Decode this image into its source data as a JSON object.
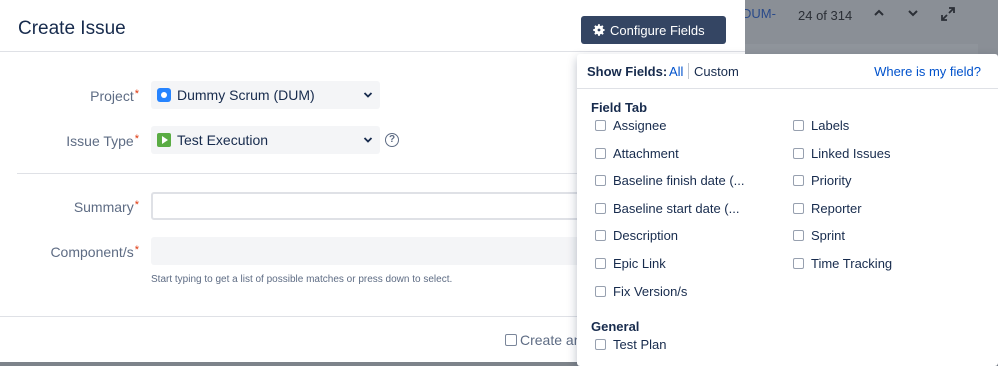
{
  "background": {
    "issue_key": "DUM-",
    "position": "24 of 314"
  },
  "modal": {
    "title": "Create Issue",
    "configure_button": "Configure Fields",
    "project": {
      "label": "Project",
      "value": "Dummy Scrum (DUM)"
    },
    "issue_type": {
      "label": "Issue Type",
      "value": "Test Execution"
    },
    "summary": {
      "label": "Summary",
      "value": ""
    },
    "components": {
      "label": "Component/s",
      "hint": "Start typing to get a list of possible matches or press down to select."
    },
    "required_marker": "*",
    "create_another": "Create an"
  },
  "panel": {
    "show_fields_label": "Show Fields:",
    "all": "All",
    "custom": "Custom",
    "where_link": "Where is my field?",
    "groups": [
      {
        "title": "Field Tab",
        "left_column": [
          "Assignee",
          "Attachment",
          "Baseline finish date (...",
          "Baseline start date (...",
          "Description",
          "Epic Link",
          "Fix Version/s"
        ],
        "right_column": [
          "Labels",
          "Linked Issues",
          "Priority",
          "Reporter",
          "Sprint",
          "Time Tracking"
        ]
      },
      {
        "title": "General",
        "left_column": [
          "Test Plan"
        ],
        "right_column": []
      }
    ]
  },
  "colors": {
    "primary_button": "#344563",
    "link": "#0052cc",
    "required": "#de350b"
  }
}
